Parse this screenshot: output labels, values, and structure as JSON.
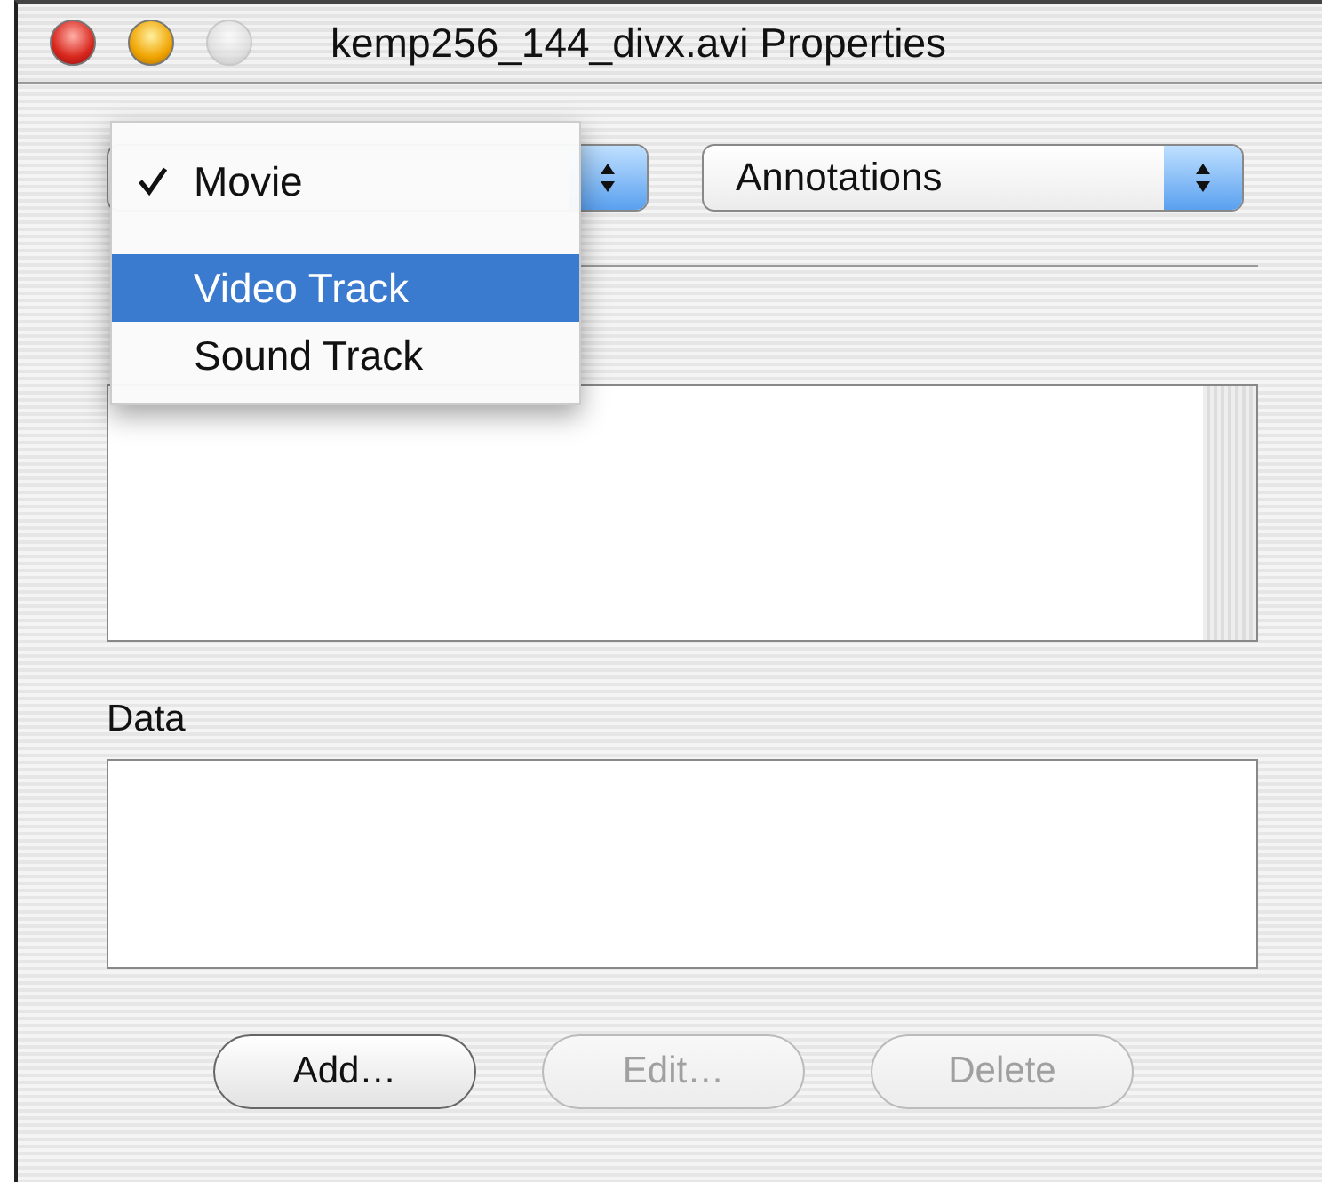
{
  "window": {
    "title": "kemp256_144_divx.avi Properties",
    "controls": [
      {
        "kind": "close",
        "disabled": false
      },
      {
        "kind": "minimize",
        "disabled": false
      },
      {
        "kind": "zoom",
        "disabled": true
      }
    ]
  },
  "track_popup": {
    "open": true,
    "menu": [
      {
        "label": "Movie",
        "checked": true,
        "selected": false
      },
      {
        "label": "Video Track",
        "checked": false,
        "selected": true
      },
      {
        "label": "Sound Track",
        "checked": false,
        "selected": false
      }
    ]
  },
  "type_popup": {
    "value": "Annotations"
  },
  "data_label": "Data",
  "buttons": [
    {
      "label": "Add…",
      "disabled": false
    },
    {
      "label": "Edit…",
      "disabled": true
    },
    {
      "label": "Delete",
      "disabled": true
    }
  ]
}
